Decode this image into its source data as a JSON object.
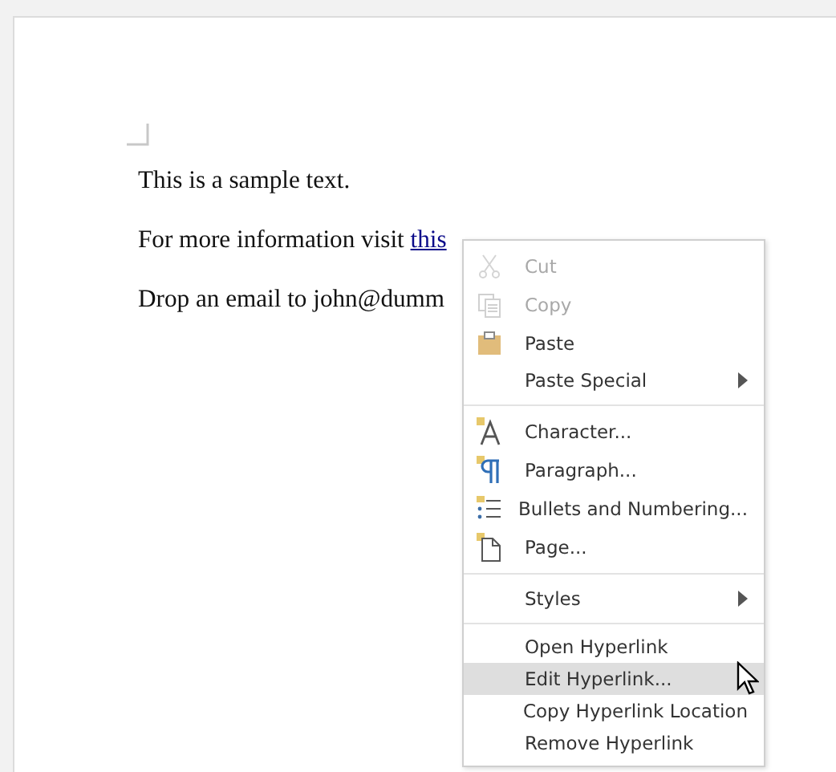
{
  "document": {
    "paragraphs": [
      {
        "text": "This is a sample text."
      },
      {
        "text": "For more information visit ",
        "link": "this"
      },
      {
        "text": "Drop an email to john@dumm"
      }
    ]
  },
  "context_menu": {
    "groups": [
      {
        "items": [
          {
            "label": "Cut",
            "disabled": true,
            "selected": false,
            "submenu": false
          },
          {
            "label": "Copy",
            "disabled": true,
            "selected": false,
            "submenu": false
          },
          {
            "label": "Paste",
            "disabled": false,
            "selected": false,
            "submenu": false
          },
          {
            "label": "Paste Special",
            "disabled": false,
            "selected": false,
            "submenu": true
          }
        ]
      },
      {
        "items": [
          {
            "label": "Character...",
            "disabled": false,
            "selected": false,
            "submenu": false
          },
          {
            "label": "Paragraph...",
            "disabled": false,
            "selected": false,
            "submenu": false
          },
          {
            "label": "Bullets and Numbering...",
            "disabled": false,
            "selected": false,
            "submenu": false
          },
          {
            "label": "Page...",
            "disabled": false,
            "selected": false,
            "submenu": false
          }
        ]
      },
      {
        "items": [
          {
            "label": "Styles",
            "disabled": false,
            "selected": false,
            "submenu": true
          }
        ]
      },
      {
        "items": [
          {
            "label": "Open Hyperlink",
            "disabled": false,
            "selected": false,
            "submenu": false
          },
          {
            "label": "Edit Hyperlink...",
            "disabled": false,
            "selected": true,
            "submenu": false
          },
          {
            "label": "Copy Hyperlink Location",
            "disabled": false,
            "selected": false,
            "submenu": false
          },
          {
            "label": "Remove Hyperlink",
            "disabled": false,
            "selected": false,
            "submenu": false
          }
        ]
      }
    ]
  }
}
